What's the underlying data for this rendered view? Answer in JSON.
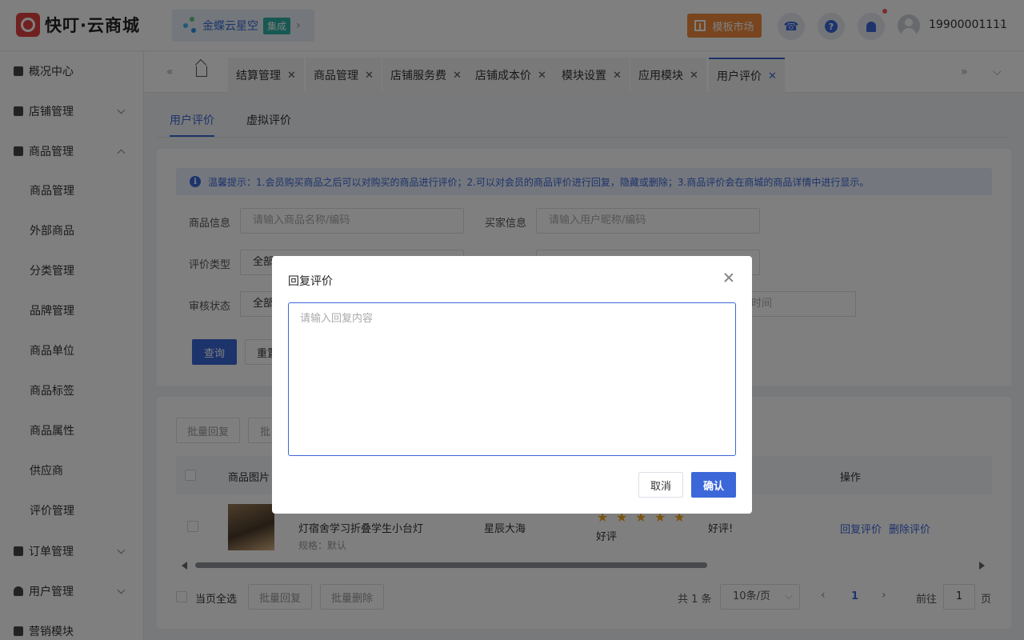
{
  "header": {
    "brand": "快叮·云商城",
    "org_name": "金蝶云星空",
    "org_badge": "集成",
    "org_chevron": "›",
    "market_label": "模板市场",
    "user_phone": "19900001111"
  },
  "sidebar": {
    "items": [
      {
        "label": "概况中心",
        "level": "top"
      },
      {
        "label": "店铺管理",
        "level": "top",
        "expand": "down"
      },
      {
        "label": "商品管理",
        "level": "top",
        "expand": "up"
      },
      {
        "label": "商品管理",
        "level": "sub"
      },
      {
        "label": "外部商品",
        "level": "sub"
      },
      {
        "label": "分类管理",
        "level": "sub"
      },
      {
        "label": "品牌管理",
        "level": "sub"
      },
      {
        "label": "商品单位",
        "level": "sub"
      },
      {
        "label": "商品标签",
        "level": "sub"
      },
      {
        "label": "商品属性",
        "level": "sub"
      },
      {
        "label": "供应商",
        "level": "sub"
      },
      {
        "label": "评价管理",
        "level": "sub"
      },
      {
        "label": "订单管理",
        "level": "top",
        "expand": "down"
      },
      {
        "label": "用户管理",
        "level": "top",
        "expand": "down"
      },
      {
        "label": "营销模块",
        "level": "top"
      }
    ]
  },
  "tabs": [
    {
      "label": "结算管理"
    },
    {
      "label": "商品管理"
    },
    {
      "label": "店铺服务费"
    },
    {
      "label": "店铺成本价"
    },
    {
      "label": "模块设置"
    },
    {
      "label": "应用模块"
    },
    {
      "label": "用户评价",
      "active": true
    }
  ],
  "subtabs": [
    "用户评价",
    "虚拟评价"
  ],
  "tip": "温馨提示：1.会员购买商品之后可以对购买的商品进行评价；2.可以对会员的商品评价进行回复，隐藏或删除；3.商品评价会在商城的商品详情中进行显示。",
  "filters": {
    "product_label": "商品信息",
    "product_placeholder": "请输入商品名称/编码",
    "buyer_label": "买家信息",
    "buyer_placeholder": "请输入用户昵称/编码",
    "rating_label": "评价类型",
    "rating_value": "全部",
    "audit_label": "审核状态",
    "audit_value": "全部",
    "end_time_placeholder": "时间",
    "query_button": "查询",
    "reset_button": "重置"
  },
  "table": {
    "batch_reply": "批量回复",
    "batch_other": "批",
    "col_image": "商品图片",
    "col_action": "操作",
    "row": {
      "product_name": "灯宿舍学习折叠学生小台灯",
      "spec": "规格：默认",
      "buyer": "星辰大海",
      "rating_stars": 5,
      "rating_text": "好评",
      "content": "好评!",
      "action_reply": "回复评价",
      "action_delete": "删除评价"
    }
  },
  "footer": {
    "select_all": "当页全选",
    "batch_reply": "批量回复",
    "batch_delete": "批量删除",
    "total": "共 1 条",
    "page_size": "10条/页",
    "current_page": "1",
    "goto_label": "前往",
    "goto_value": "1",
    "page_unit": "页"
  },
  "dialog": {
    "title": "回复评价",
    "placeholder": "请输入回复内容",
    "cancel": "取消",
    "confirm": "确认"
  },
  "colors": {
    "primary": "#3b67d8",
    "market": "#f08a3c",
    "badge": "#2eb0a4",
    "star": "#f5a623"
  }
}
